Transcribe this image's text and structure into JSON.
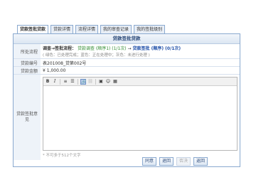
{
  "tabs": [
    {
      "label": "贷款签批贷款"
    },
    {
      "label": "贷款详情"
    },
    {
      "label": "流程详情"
    },
    {
      "label": "我的审查记录"
    },
    {
      "label": "我的签批级别"
    }
  ],
  "panel": {
    "title": "贷款签批贷款"
  },
  "rows": {
    "flow": {
      "label": "所处流程",
      "line_prefix": "调查→签批流程：",
      "line_survey": "贷款调查 (顺序1) (1/1次)",
      "line_arrow": "→",
      "line_sign": "贷款签批 (顺序) (0/1次)",
      "hint": "( 绿色：已处理完成；蓝色：正在处理中；灰色：未进行处理 )"
    },
    "loan_no": {
      "label": "贷款编号",
      "value": "表201008_贷第002号"
    },
    "amount": {
      "label": "贷款金额",
      "value": "¥ 1,000.00"
    },
    "opinion": {
      "label": "贷款签批意见",
      "note": "* 不可多于512个文字"
    }
  },
  "toolbar": {
    "bold": "B",
    "italic": "I",
    "ordered_list": "≡",
    "unordered_list": "☰",
    "link": "🔗",
    "unlink": "⛓",
    "image": "▣",
    "emoticon": "☺",
    "table": "▦"
  },
  "buttons": {
    "agree": "同意",
    "return": "退回",
    "reject": "否决",
    "back": "返回"
  }
}
